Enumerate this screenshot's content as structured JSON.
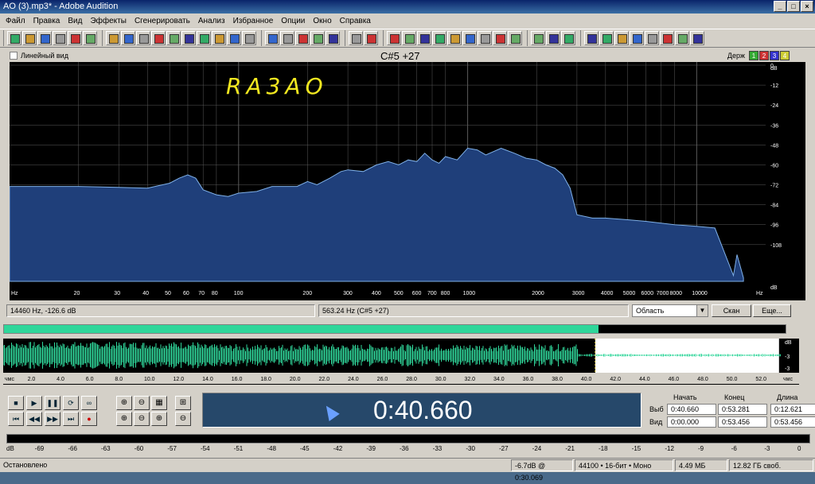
{
  "window": {
    "title": "AO (3).mp3* - Adobe Audition"
  },
  "menu": [
    "Файл",
    "Правка",
    "Вид",
    "Эффекты",
    "Сгенерировать",
    "Анализ",
    "Избранное",
    "Опции",
    "Окно",
    "Справка"
  ],
  "spectrum": {
    "linear_view_label": "Линейный вид",
    "note_label": "C#5 +27",
    "hold_label": "Держ",
    "hold_buttons": [
      "1",
      "2",
      "3",
      "4"
    ],
    "annotation": "RA3AO",
    "x_ticks": [
      "Hz",
      "20",
      "30",
      "40",
      "50",
      "60",
      "70",
      "80",
      "100",
      "200",
      "300",
      "400",
      "500",
      "600",
      "700",
      "800",
      "1000",
      "2000",
      "3000",
      "4000",
      "5000",
      "6000",
      "7000",
      "8000",
      "10000",
      "Hz"
    ],
    "x_tick_freqs": [
      null,
      20,
      30,
      40,
      50,
      60,
      70,
      80,
      100,
      200,
      300,
      400,
      500,
      600,
      700,
      800,
      1000,
      2000,
      3000,
      4000,
      5000,
      6000,
      7000,
      8000,
      10000,
      null
    ],
    "y_ticks": [
      "dB",
      "0",
      "-12",
      "-24",
      "-36",
      "-48",
      "-60",
      "-72",
      "-84",
      "-96",
      "-108",
      "dB"
    ],
    "curve_color": "#1f3f7a",
    "curve_points_hz_db": [
      [
        10,
        -73
      ],
      [
        20,
        -73
      ],
      [
        30,
        -73.5
      ],
      [
        40,
        -74
      ],
      [
        50,
        -71
      ],
      [
        55,
        -68
      ],
      [
        60,
        -66
      ],
      [
        65,
        -68
      ],
      [
        70,
        -75
      ],
      [
        80,
        -78
      ],
      [
        90,
        -79
      ],
      [
        100,
        -77
      ],
      [
        120,
        -76
      ],
      [
        140,
        -73
      ],
      [
        160,
        -73
      ],
      [
        180,
        -73
      ],
      [
        200,
        -70
      ],
      [
        220,
        -72
      ],
      [
        250,
        -68
      ],
      [
        280,
        -64
      ],
      [
        300,
        -63
      ],
      [
        350,
        -64
      ],
      [
        400,
        -60
      ],
      [
        450,
        -58
      ],
      [
        500,
        -60
      ],
      [
        550,
        -57
      ],
      [
        600,
        -58
      ],
      [
        650,
        -53
      ],
      [
        700,
        -57
      ],
      [
        750,
        -59
      ],
      [
        800,
        -55
      ],
      [
        900,
        -57
      ],
      [
        1000,
        -50
      ],
      [
        1100,
        -51
      ],
      [
        1200,
        -54
      ],
      [
        1400,
        -50
      ],
      [
        1600,
        -53
      ],
      [
        1800,
        -56
      ],
      [
        2000,
        -57
      ],
      [
        2200,
        -60
      ],
      [
        2400,
        -62
      ],
      [
        2600,
        -66
      ],
      [
        2800,
        -74
      ],
      [
        3000,
        -90
      ],
      [
        3500,
        -92
      ],
      [
        4000,
        -92
      ],
      [
        5000,
        -93
      ],
      [
        6000,
        -94
      ],
      [
        8000,
        -96
      ],
      [
        10000,
        -97
      ],
      [
        12000,
        -98
      ],
      [
        14460,
        -126.6
      ],
      [
        15000,
        -114
      ],
      [
        16000,
        -128
      ]
    ]
  },
  "status_row": {
    "cursor_readout": "14460 Hz, -126.6 dB",
    "peak_readout": "563.24 Hz (C#5 +27)",
    "range_select": "Область",
    "scan_button": "Скан",
    "more_button": "Еще..."
  },
  "waveform": {
    "timeline_labels": [
      "чмс",
      "2.0",
      "4.0",
      "6.0",
      "8.0",
      "10.0",
      "12.0",
      "14.0",
      "16.0",
      "18.0",
      "20.0",
      "22.0",
      "24.0",
      "26.0",
      "28.0",
      "30.0",
      "32.0",
      "34.0",
      "36.0",
      "38.0",
      "40.0",
      "42.0",
      "44.0",
      "46.0",
      "48.0",
      "50.0",
      "52.0",
      "чмс"
    ],
    "db_labels": [
      "dB",
      "-3",
      "-3"
    ],
    "selection_start_s": 40.66,
    "selection_end_s": 53.281,
    "total_s": 53.456,
    "wave_color": "#2fd69a"
  },
  "transport": {
    "buttons": [
      "■",
      "▶",
      "❚❚",
      "⟳",
      "∞",
      "⏮",
      "◀◀",
      "▶▶",
      "⏭",
      "●"
    ]
  },
  "zoom": {
    "buttons": [
      "⊕",
      "⊖",
      "▦",
      "⊞",
      "⊕",
      "⊖",
      "⊕",
      "⊖"
    ]
  },
  "time": {
    "display": "0:40.660"
  },
  "selection_panel": {
    "headers": [
      "Начать",
      "Конец",
      "Длина"
    ],
    "row_labels": [
      "Выб",
      "Вид"
    ],
    "sel_values": [
      "0:40.660",
      "0:53.281",
      "0:12.621"
    ],
    "view_values": [
      "0:00.000",
      "0:53.456",
      "0:53.456"
    ]
  },
  "meter": {
    "scale": [
      "dB",
      "-69",
      "-66",
      "-63",
      "-60",
      "-57",
      "-54",
      "-51",
      "-48",
      "-45",
      "-42",
      "-39",
      "-36",
      "-33",
      "-30",
      "-27",
      "-24",
      "-21",
      "-18",
      "-15",
      "-12",
      "-9",
      "-6",
      "-3",
      "0"
    ]
  },
  "statusbar": {
    "state": "Остановлено",
    "level": "-6.7dB @  0:30.069",
    "format": "44100 • 16-бит • Моно",
    "size": "4.49 МБ",
    "free": "12.82 ГБ своб."
  }
}
